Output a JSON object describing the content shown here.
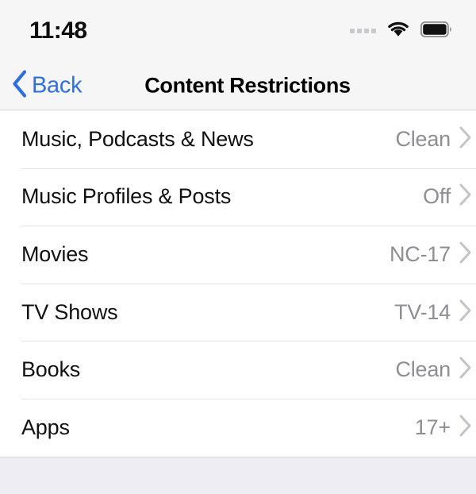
{
  "status_bar": {
    "time": "11:48",
    "signal_icon": "signal-dots-icon",
    "wifi_icon": "wifi-icon",
    "battery_icon": "battery-full-icon"
  },
  "nav_bar": {
    "back_label": "Back",
    "back_icon": "chevron-left-icon",
    "title": "Content Restrictions"
  },
  "list": {
    "rows": [
      {
        "label": "Music, Podcasts & News",
        "value": "Clean",
        "chevron": "chevron-right-icon"
      },
      {
        "label": "Music Profiles & Posts",
        "value": "Off",
        "chevron": "chevron-right-icon"
      },
      {
        "label": "Movies",
        "value": "NC-17",
        "chevron": "chevron-right-icon"
      },
      {
        "label": "TV Shows",
        "value": "TV-14",
        "chevron": "chevron-right-icon"
      },
      {
        "label": "Books",
        "value": "Clean",
        "chevron": "chevron-right-icon"
      },
      {
        "label": "Apps",
        "value": "17+",
        "chevron": "chevron-right-icon"
      }
    ]
  },
  "colors": {
    "accent_blue": "#2f6fe0",
    "value_gray": "#8e8e93",
    "chevron_gray": "#c4c4c8",
    "bar_background": "#f6f6f7",
    "footer_background": "#efedf4",
    "separator": "#e3e3e6"
  }
}
